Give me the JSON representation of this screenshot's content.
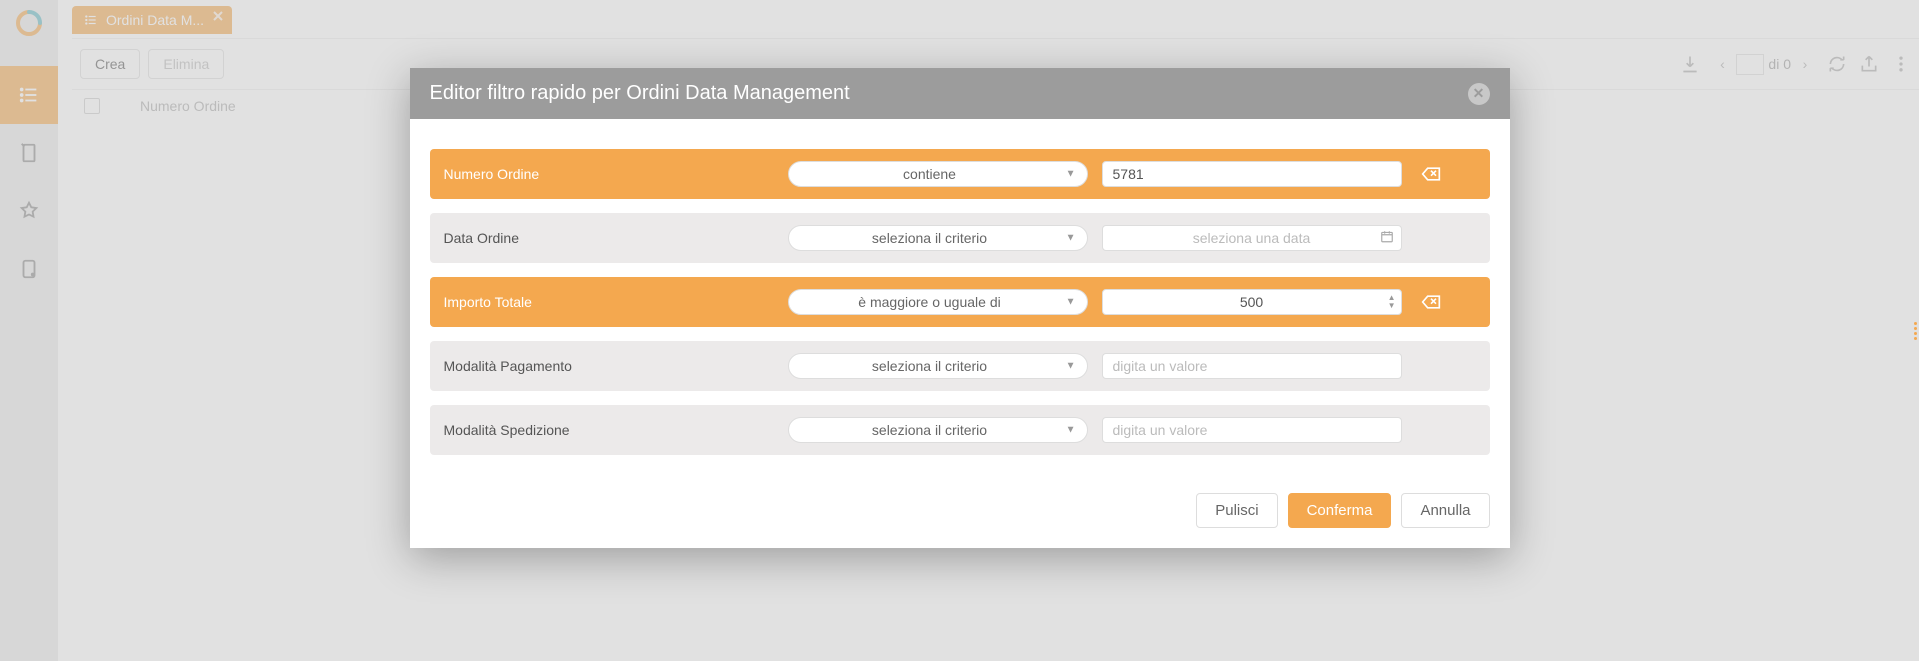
{
  "tab": {
    "title": "Ordini Data M..."
  },
  "toolbar": {
    "create": "Crea",
    "delete": "Elimina",
    "page_input": "",
    "page_of_label": "di 0"
  },
  "grid": {
    "col_numero": "Numero Ordine"
  },
  "modal": {
    "title": "Editor filtro rapido per Ordini Data Management",
    "rows": [
      {
        "label": "Numero Ordine",
        "criterion": "contiene",
        "value": "5781",
        "placeholder": "",
        "active": true,
        "clearable": true,
        "value_kind": "text"
      },
      {
        "label": "Data Ordine",
        "criterion": "seleziona il criterio",
        "value": "",
        "placeholder": "seleziona una data",
        "active": false,
        "clearable": false,
        "value_kind": "date"
      },
      {
        "label": "Importo Totale",
        "criterion": "è maggiore o uguale di",
        "value": "500",
        "placeholder": "",
        "active": true,
        "clearable": true,
        "value_kind": "number"
      },
      {
        "label": "Modalità Pagamento",
        "criterion": "seleziona il criterio",
        "value": "",
        "placeholder": "digita un valore",
        "active": false,
        "clearable": false,
        "value_kind": "text"
      },
      {
        "label": "Modalità Spedizione",
        "criterion": "seleziona il criterio",
        "value": "",
        "placeholder": "digita un valore",
        "active": false,
        "clearable": false,
        "value_kind": "text"
      }
    ],
    "buttons": {
      "clear": "Pulisci",
      "confirm": "Conferma",
      "cancel": "Annulla"
    }
  }
}
